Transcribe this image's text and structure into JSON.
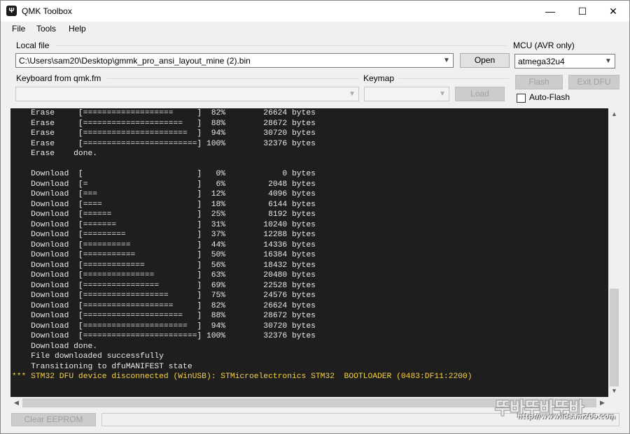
{
  "window": {
    "title": "QMK Toolbox",
    "controls": [
      "—",
      "☐",
      "✕"
    ]
  },
  "menu": [
    "File",
    "Tools",
    "Help"
  ],
  "local_file": {
    "label": "Local file",
    "value": "C:\\Users\\sam20\\Desktop\\gmmk_pro_ansi_layout_mine (2).bin",
    "open_label": "Open"
  },
  "mcu": {
    "label": "MCU (AVR only)",
    "value": "atmega32u4"
  },
  "keyboard": {
    "label": "Keyboard from qmk.fm",
    "value": ""
  },
  "keymap": {
    "label": "Keymap",
    "value": "",
    "load_label": "Load"
  },
  "actions": {
    "flash_label": "Flash",
    "exit_dfu_label": "Exit DFU",
    "auto_flash_label": "Auto-Flash",
    "auto_flash_checked": false,
    "clear_eeprom_label": "Clear EEPROM"
  },
  "console": {
    "text_color": "#ebebeb",
    "highlight_color": "#f5d242",
    "lines": [
      {
        "text": "    Erase     [===================     ]  82%        26624 bytes"
      },
      {
        "text": "    Erase     [=====================   ]  88%        28672 bytes"
      },
      {
        "text": "    Erase     [======================  ]  94%        30720 bytes"
      },
      {
        "text": "    Erase     [========================] 100%        32376 bytes"
      },
      {
        "text": "    Erase    done."
      },
      {
        "text": ""
      },
      {
        "text": "    Download  [                        ]   0%            0 bytes"
      },
      {
        "text": "    Download  [=                       ]   6%         2048 bytes"
      },
      {
        "text": "    Download  [===                     ]  12%         4096 bytes"
      },
      {
        "text": "    Download  [====                    ]  18%         6144 bytes"
      },
      {
        "text": "    Download  [======                  ]  25%         8192 bytes"
      },
      {
        "text": "    Download  [=======                 ]  31%        10240 bytes"
      },
      {
        "text": "    Download  [=========               ]  37%        12288 bytes"
      },
      {
        "text": "    Download  [==========              ]  44%        14336 bytes"
      },
      {
        "text": "    Download  [===========             ]  50%        16384 bytes"
      },
      {
        "text": "    Download  [=============           ]  56%        18432 bytes"
      },
      {
        "text": "    Download  [===============         ]  63%        20480 bytes"
      },
      {
        "text": "    Download  [================        ]  69%        22528 bytes"
      },
      {
        "text": "    Download  [==================      ]  75%        24576 bytes"
      },
      {
        "text": "    Download  [===================     ]  82%        26624 bytes"
      },
      {
        "text": "    Download  [=====================   ]  88%        28672 bytes"
      },
      {
        "text": "    Download  [======================  ]  94%        30720 bytes"
      },
      {
        "text": "    Download  [========================] 100%        32376 bytes"
      },
      {
        "text": "    Download done."
      },
      {
        "text": "    File downloaded successfully"
      },
      {
        "text": "    Transitioning to dfuMANIFEST state"
      },
      {
        "text": "*** STM32 DFU device disconnected (WinUSB): STMicroelectronics STM32  BOOTLOADER (0483:DF11:2200)",
        "highlight": true
      }
    ]
  },
  "status": "",
  "watermark": {
    "title": "뚜바뚜바뚜바",
    "url": "http://www.idsam209.com"
  }
}
